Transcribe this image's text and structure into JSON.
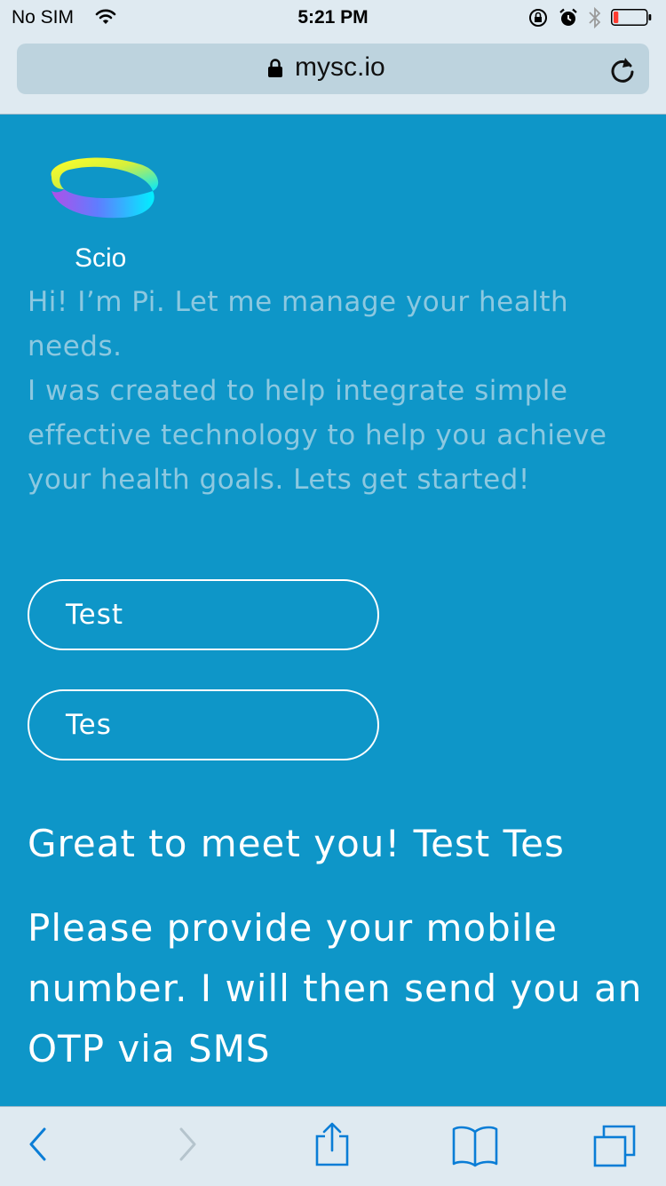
{
  "status_bar": {
    "carrier": "No SIM",
    "time": "5:21 PM",
    "icons": [
      "wifi-icon",
      "rotation-lock-icon",
      "alarm-icon",
      "bluetooth-icon",
      "battery-icon"
    ],
    "battery_level": 0.15
  },
  "browser": {
    "url": "mysc.io"
  },
  "app": {
    "brand_name": "Scio",
    "intro_lines": [
      "Hi! I’m Pi. Let me manage your health needs.",
      "I was created to help integrate simple effective technology to help you achieve your health goals. Lets get started!"
    ],
    "first_name_value": "Test",
    "last_name_value": "Tes",
    "greeting": "Great to meet you! Test Tes",
    "prompt": "Please provide your mobile number. I will then send you an OTP via SMS"
  },
  "toolbar": {
    "icons": [
      "back-icon",
      "forward-icon",
      "share-icon",
      "bookmarks-icon",
      "tabs-icon"
    ]
  },
  "colors": {
    "background": "#0e96c8",
    "intro_text": "#8cc8e0",
    "chrome": "#dfeaf1",
    "url_field": "#bdd3de",
    "ios_blue": "#0a7dd6",
    "battery_low": "#ff3b30"
  }
}
